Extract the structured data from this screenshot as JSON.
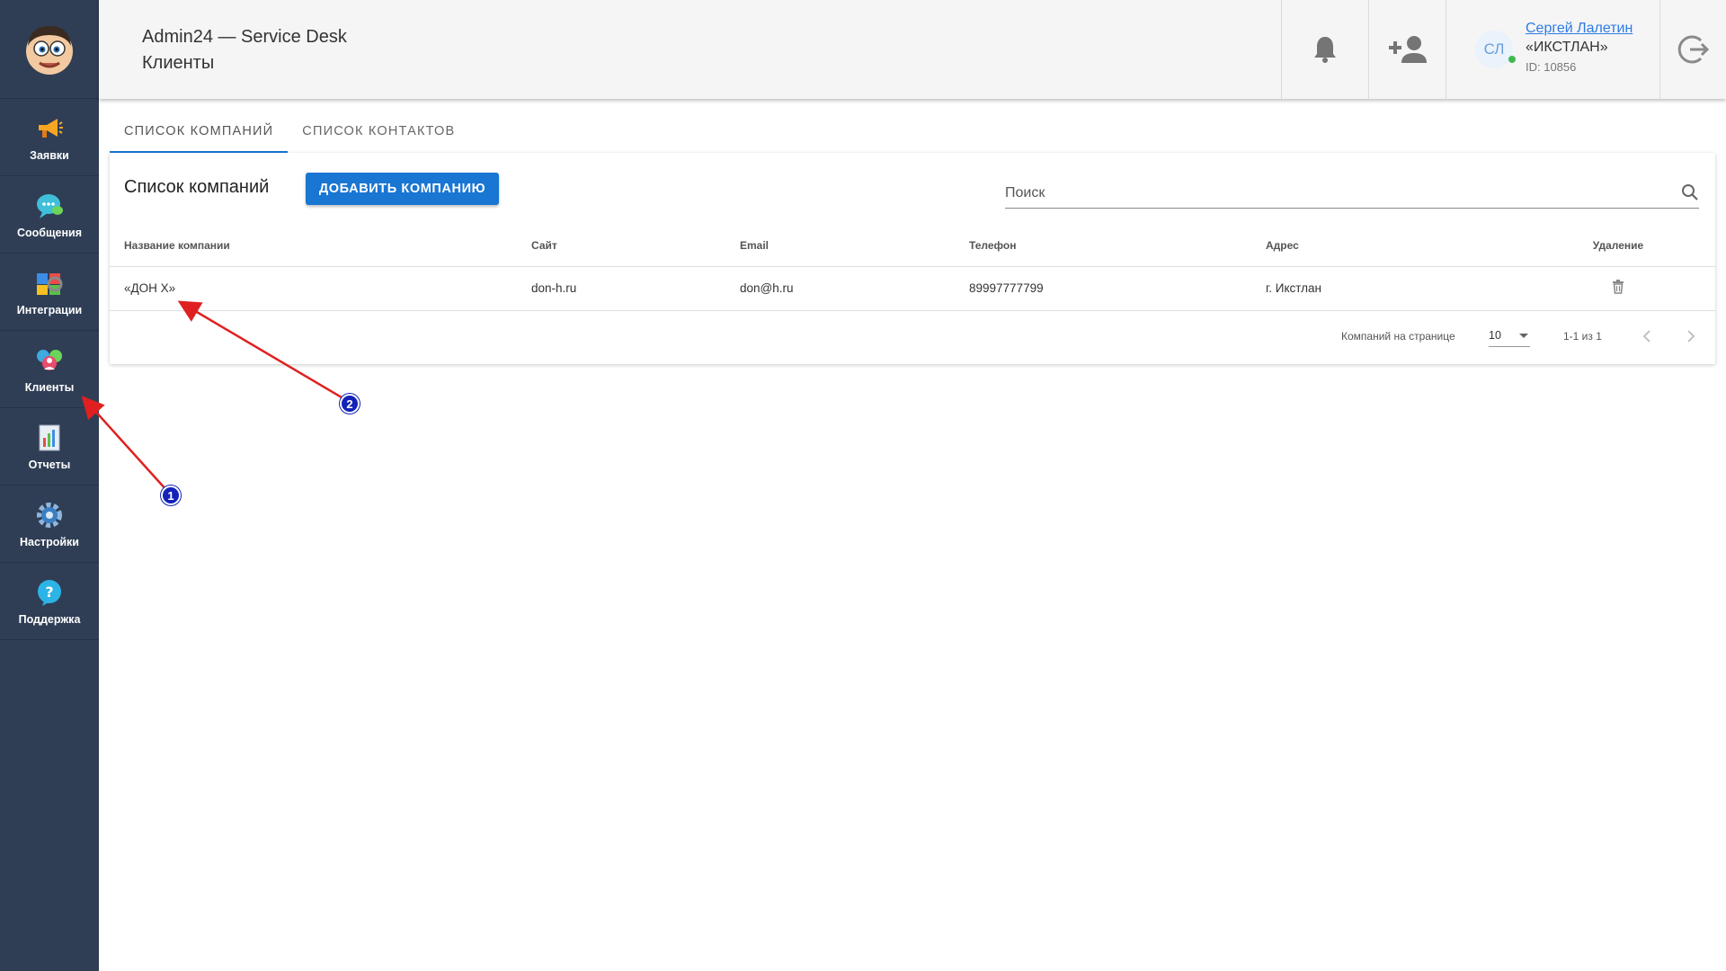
{
  "sidebar": {
    "items": [
      {
        "label": "Заявки",
        "icon": "megaphone-icon"
      },
      {
        "label": "Сообщения",
        "icon": "chat-bubble-icon"
      },
      {
        "label": "Интеграции",
        "icon": "puzzle-icon"
      },
      {
        "label": "Клиенты",
        "icon": "people-icon"
      },
      {
        "label": "Отчеты",
        "icon": "report-chart-icon"
      },
      {
        "label": "Настройки",
        "icon": "gear-icon"
      },
      {
        "label": "Поддержка",
        "icon": "help-icon"
      }
    ]
  },
  "header": {
    "title": "Admin24 — Service Desk",
    "subtitle": "Клиенты",
    "user": {
      "initials": "СЛ",
      "name": "Сергей Лалетин",
      "company": "«ИКСТЛАН»",
      "id": "ID: 10856"
    }
  },
  "tabs": [
    {
      "label": "Список компаний",
      "active": true
    },
    {
      "label": "Список контактов",
      "active": false
    }
  ],
  "card": {
    "title": "Список компаний",
    "add_button": "Добавить компанию",
    "search_placeholder": "Поиск"
  },
  "table": {
    "columns": [
      "Название компании",
      "Сайт",
      "Email",
      "Телефон",
      "Адрес",
      "Удаление"
    ],
    "rows": [
      {
        "name": "«ДОН Х»",
        "site": "don-h.ru",
        "email": "don@h.ru",
        "phone": "89997777799",
        "address": "г. Икстлан"
      }
    ]
  },
  "pagination": {
    "rows_label": "Компаний на странице",
    "rows_per_page": "10",
    "range": "1-1 из 1"
  },
  "annotations": [
    "1",
    "2"
  ],
  "colors": {
    "sidebar_bg": "#2f3e55",
    "primary": "#1976d2",
    "arrow": "#e02020",
    "badge": "#1322b8"
  }
}
